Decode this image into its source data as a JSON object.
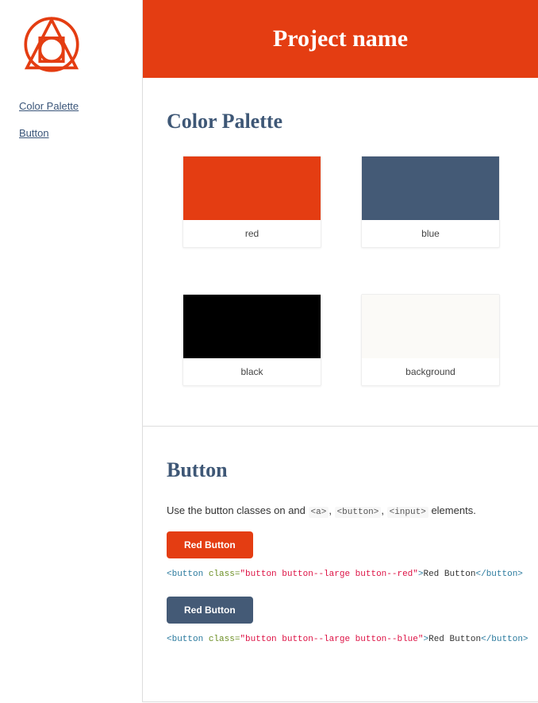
{
  "colors": {
    "red": "#e43d12",
    "blue": "#445a76",
    "black": "#000000",
    "background": "#fbfaf7"
  },
  "header": {
    "title": "Project name"
  },
  "sidebar": {
    "nav": [
      {
        "label": "Color Palette",
        "target": "color-palette"
      },
      {
        "label": "Button",
        "target": "button"
      }
    ]
  },
  "sections": {
    "palette": {
      "heading": "Color Palette",
      "swatches": [
        {
          "name": "red",
          "color_key": "red"
        },
        {
          "name": "blue",
          "color_key": "blue"
        },
        {
          "name": "black",
          "color_key": "black"
        },
        {
          "name": "background",
          "color_key": "background"
        }
      ]
    },
    "button": {
      "heading": "Button",
      "description_pre": "Use the button classes on and ",
      "description_codes": [
        "<a>",
        "<button>",
        "<input>"
      ],
      "description_post": " elements.",
      "examples": [
        {
          "label": "Red Button",
          "variant": "red",
          "snippet": {
            "open_tag": "<button",
            "attr_name": " class=",
            "attr_value": "\"button button--large button--red\"",
            "open_close": ">",
            "text": "Red Button",
            "close_tag": "</button>"
          }
        },
        {
          "label": "Red Button",
          "variant": "blue",
          "snippet": {
            "open_tag": "<button",
            "attr_name": " class=",
            "attr_value": "\"button button--large button--blue\"",
            "open_close": ">",
            "text": "Red Button",
            "close_tag": "</button>"
          }
        }
      ]
    }
  }
}
